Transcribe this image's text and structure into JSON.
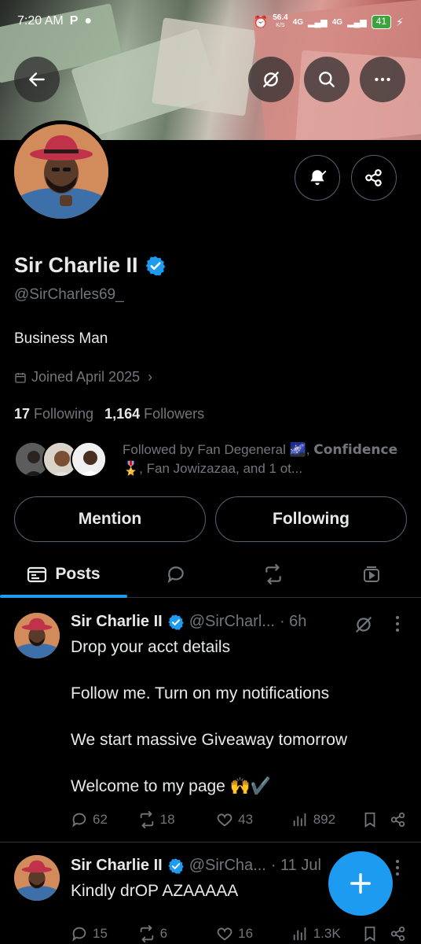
{
  "status_bar": {
    "time": "7:20 AM",
    "app_indicator": "P",
    "net_speed": "56.4",
    "net_unit": "K/S",
    "net_1": "4G",
    "net_2": "4G",
    "battery": "41"
  },
  "profile": {
    "name": "Sir Charlie II",
    "handle": "@SirCharles69_",
    "bio": "Business Man",
    "joined": "Joined April 2025",
    "following_count": "17",
    "following_label": "Following",
    "followers_count": "1,164",
    "followers_label": "Followers",
    "followed_by": "Followed by Fan Degeneral 🌌, 𝗖𝗼𝗻𝗳𝗶𝗱𝗲𝗻𝗰𝗲 🎖️, Fan Jowizazaa, and 1 ot..."
  },
  "buttons": {
    "mention": "Mention",
    "following": "Following"
  },
  "tabs": {
    "posts": "Posts"
  },
  "posts": [
    {
      "name": "Sir Charlie II",
      "handle": "@SirCharl...",
      "time": "· 6h",
      "lines": [
        "Drop your acct details",
        "Follow me. Turn on my notifications",
        "We start massive Giveaway tomorrow",
        "Welcome to my page 🙌✔️"
      ],
      "replies": "62",
      "reposts": "18",
      "likes": "43",
      "views": "892"
    },
    {
      "name": "Sir Charlie II",
      "handle": "@SirCha...",
      "time": "· 11 Jul",
      "lines": [
        "Kindly drOP AZAAAAA"
      ],
      "replies": "15",
      "reposts": "6",
      "likes": "16",
      "views": "1.3K"
    }
  ],
  "colors": {
    "accent": "#1d9bf0",
    "background": "#000000",
    "muted": "#71767b"
  }
}
